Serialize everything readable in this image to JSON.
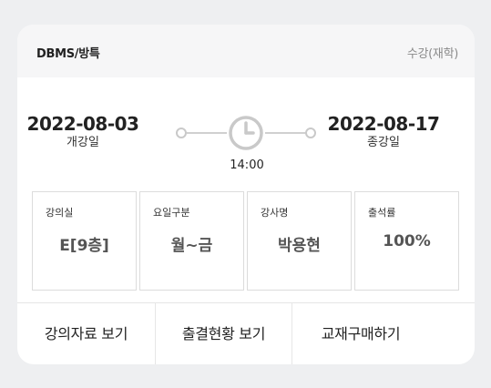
{
  "course": {
    "title": "DBMS/방특",
    "type": "수강(재학)"
  },
  "schedule": {
    "start_date": "2022-08-03",
    "start_label": "개강일",
    "end_date": "2022-08-17",
    "end_label": "종강일",
    "time": "14:00",
    "time_icon": "clock-icon"
  },
  "info": [
    {
      "label": "강의실",
      "value": "E[9층]"
    },
    {
      "label": "요일구분",
      "value": "월~금"
    },
    {
      "label": "강사명",
      "value": "박용현"
    },
    {
      "label": "출석률",
      "value": "100%"
    }
  ],
  "actions": [
    {
      "label": "강의자료 보기"
    },
    {
      "label": "출결현황 보기"
    },
    {
      "label": "교재구매하기"
    }
  ],
  "colors": {
    "background": "#eeeff1",
    "card": "#ffffff",
    "header": "#f6f6f7",
    "muted_text": "#8a8a8a",
    "icon_gray": "#c9c9c9"
  }
}
